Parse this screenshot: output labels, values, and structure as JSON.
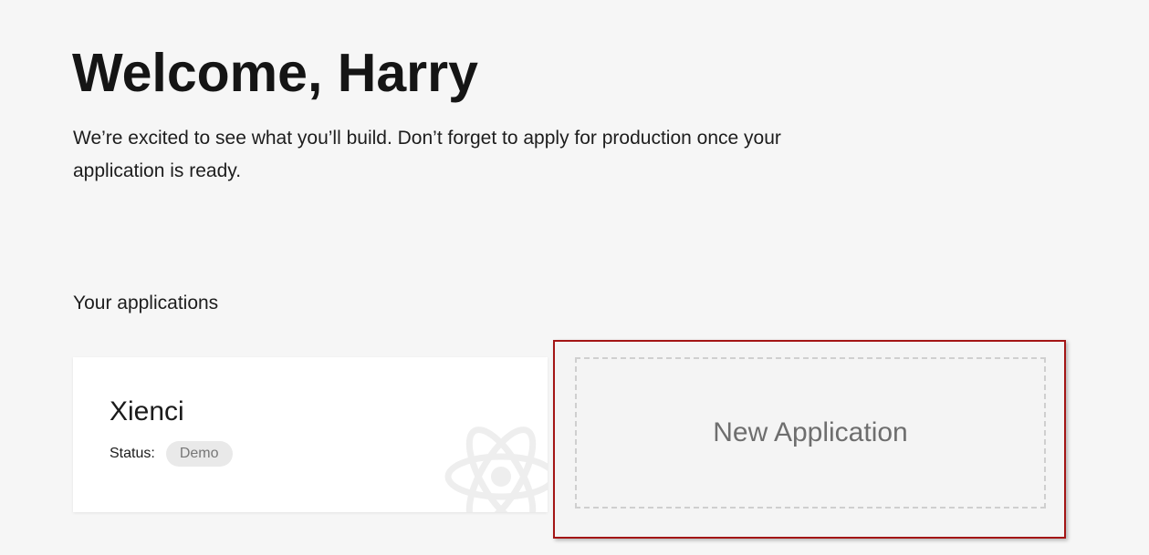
{
  "header": {
    "title": "Welcome, Harry",
    "intro": "We’re excited to see what you’ll build. Don’t forget to apply for production once your application is ready."
  },
  "applications": {
    "heading": "Your applications",
    "items": [
      {
        "name": "Xienci",
        "status_label": "Status:",
        "status_value": "Demo",
        "icon": "react-atom-icon"
      }
    ],
    "new_application_label": "New Application"
  },
  "colors": {
    "background": "#f6f6f6",
    "card": "#ffffff",
    "highlight_border": "#a31515",
    "badge_background": "#e9e9e9",
    "dashed_border": "#cfcfcf"
  }
}
